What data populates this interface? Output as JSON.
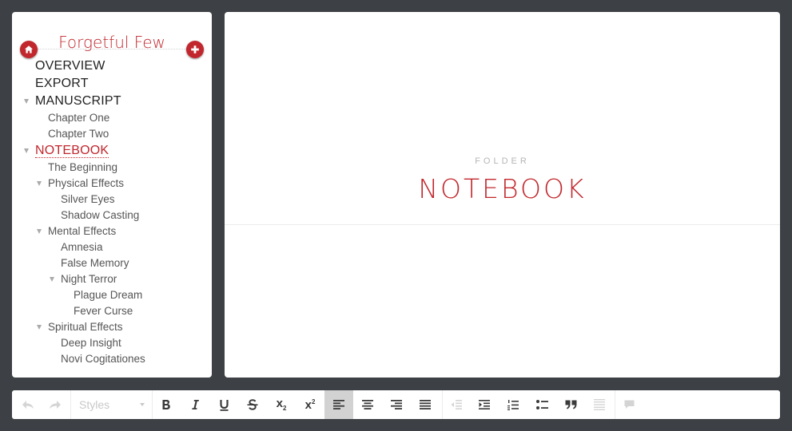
{
  "sidebar": {
    "project_title": "Forgetful Few",
    "tree": [
      {
        "label": "OVERVIEW",
        "level": 0
      },
      {
        "label": "EXPORT",
        "level": 0
      },
      {
        "label": "MANUSCRIPT",
        "level": 0,
        "expanded": true
      },
      {
        "label": "Chapter One",
        "level": 1
      },
      {
        "label": "Chapter Two",
        "level": 1
      },
      {
        "label": "NOTEBOOK",
        "level": 0,
        "expanded": true,
        "selected": true
      },
      {
        "label": "The Beginning",
        "level": 1
      },
      {
        "label": "Physical Effects",
        "level": 1,
        "expanded": true
      },
      {
        "label": "Silver Eyes",
        "level": 2
      },
      {
        "label": "Shadow Casting",
        "level": 2
      },
      {
        "label": "Mental Effects",
        "level": 1,
        "expanded": true
      },
      {
        "label": "Amnesia",
        "level": 2
      },
      {
        "label": "False Memory",
        "level": 2
      },
      {
        "label": "Night Terror",
        "level": 2,
        "expanded": true
      },
      {
        "label": "Plague Dream",
        "level": 3
      },
      {
        "label": "Fever Curse",
        "level": 3
      },
      {
        "label": "Spiritual Effects",
        "level": 1,
        "expanded": true
      },
      {
        "label": "Deep Insight",
        "level": 2
      },
      {
        "label": "Novi Cogitationes",
        "level": 2
      }
    ]
  },
  "document": {
    "type_label": "FOLDER",
    "title": "NOTEBOOK"
  },
  "toolbar": {
    "styles_label": "Styles",
    "subscript_base": "x",
    "subscript_mark": "2",
    "superscript_base": "x",
    "superscript_mark": "2"
  },
  "icons": {
    "home": "home-icon",
    "add": "plus-icon",
    "undo": "undo-icon",
    "redo": "redo-icon",
    "bold": "bold-icon",
    "italic": "italic-icon",
    "underline": "underline-icon",
    "strikethrough": "strikethrough-icon",
    "align_left": "align-left-icon",
    "align_center": "align-center-icon",
    "align_right": "align-right-icon",
    "justify": "justify-icon",
    "outdent": "outdent-icon",
    "indent": "indent-icon",
    "ordered_list": "ordered-list-icon",
    "bullet_list": "bullet-list-icon",
    "blockquote": "blockquote-icon",
    "horizontal_rule": "horizontal-rule-icon",
    "comment": "comment-icon"
  },
  "colors": {
    "accent": "#c1272d",
    "background": "#3d4044",
    "panel": "#ffffff",
    "active_button": "#d2d2d2"
  }
}
